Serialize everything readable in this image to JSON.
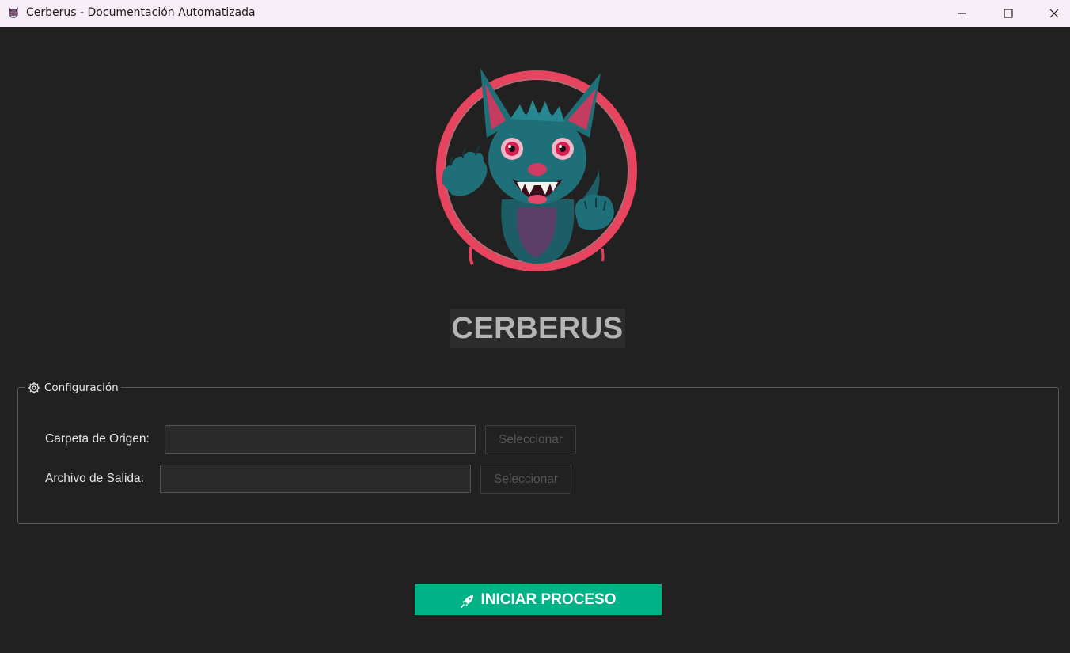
{
  "window": {
    "title": "Cerberus - Documentación Automatizada"
  },
  "app": {
    "heading": "CERBERUS"
  },
  "config": {
    "legend": "Configuración",
    "source_folder": {
      "label": "Carpeta de Origen:",
      "value": "",
      "button": "Seleccionar"
    },
    "output_file": {
      "label": "Archivo de Salida:",
      "value": "",
      "button": "Seleccionar"
    }
  },
  "actions": {
    "start_label": "INICIAR PROCESO"
  },
  "colors": {
    "background": "#212121",
    "accent": "#00b386",
    "logo_ring": "#e8435f",
    "mascot": "#1f6f78"
  },
  "icons": {
    "app": "cerberus-mascot-icon",
    "legend": "gear-icon",
    "start": "rocket-icon"
  }
}
